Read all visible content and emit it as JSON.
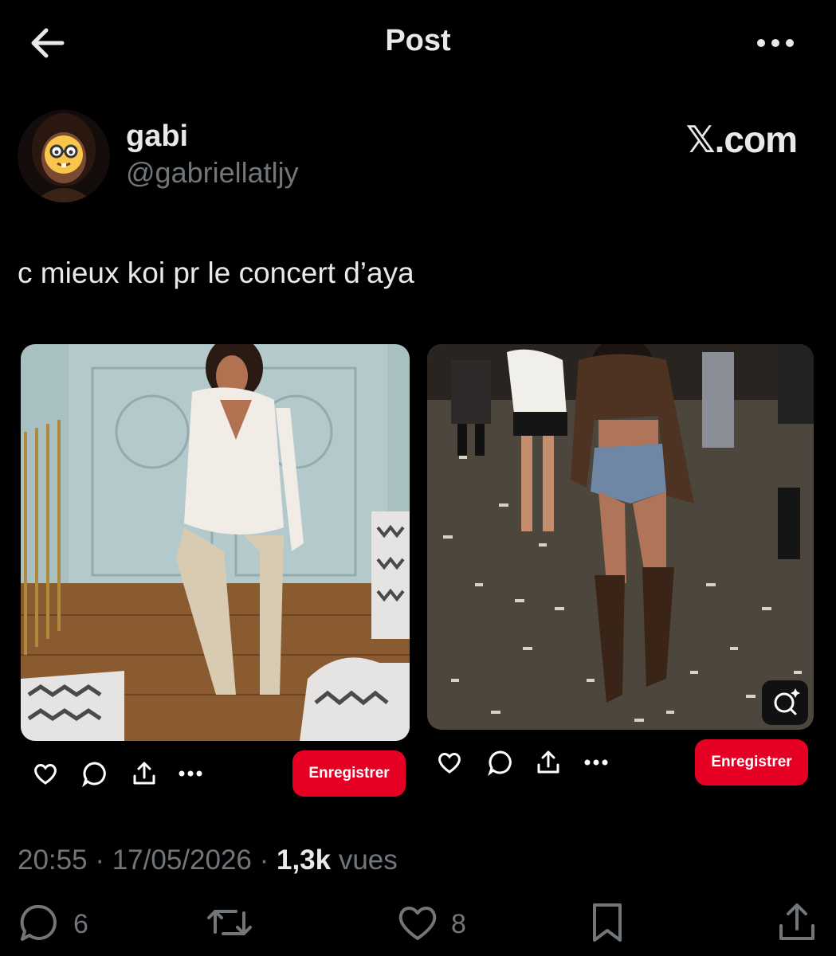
{
  "header": {
    "title": "Post",
    "back_icon": "arrow-left-icon",
    "more_icon": "more-horizontal-icon"
  },
  "author": {
    "name": "gabi",
    "handle": "@gabriellatljy",
    "avatar_emoji": "🤓",
    "brand": "𝕏.com"
  },
  "tweet": {
    "text": "c mieux koi pr le concert d’aya"
  },
  "pins": [
    {
      "save_label": "Enregistrer",
      "icons": [
        "heart-icon",
        "comment-icon",
        "share-icon",
        "more-icon"
      ]
    },
    {
      "save_label": "Enregistrer",
      "icons": [
        "heart-icon",
        "comment-icon",
        "share-icon",
        "more-icon"
      ],
      "lens_icon": "visual-search-icon"
    }
  ],
  "meta": {
    "time": "20:55",
    "sep1": " · ",
    "date": "17/05/2026",
    "sep2": " · ",
    "views_count": "1,3k",
    "views_label": " vues"
  },
  "engagement": {
    "replies": "6",
    "likes": "8"
  },
  "colors": {
    "background": "#000000",
    "text": "#e7e9ea",
    "muted": "#71767b",
    "pinterest_red": "#e60023"
  }
}
